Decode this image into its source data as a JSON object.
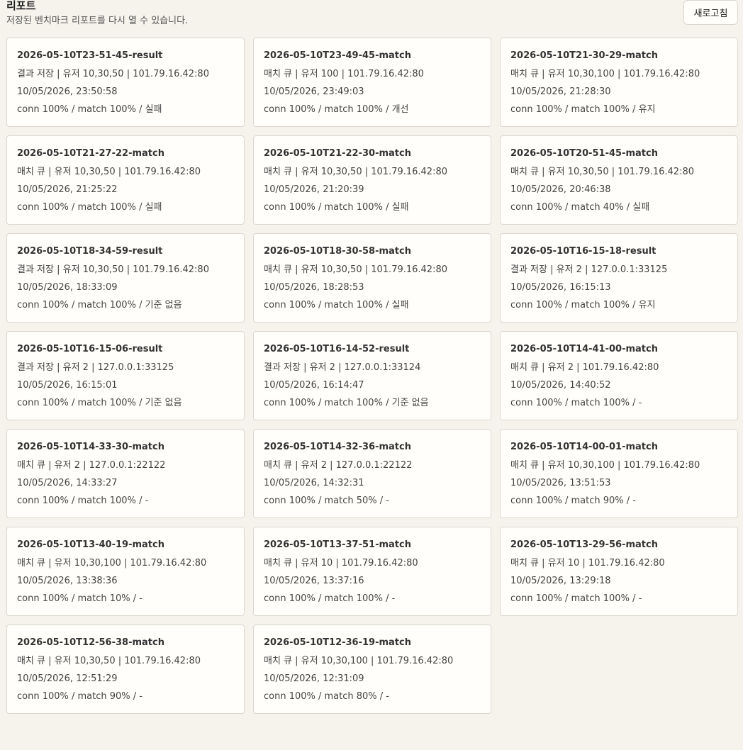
{
  "header": {
    "title": "리포트",
    "subtitle": "저장된 벤치마크 리포트를 다시 열 수 있습니다.",
    "refresh_label": "새로고침"
  },
  "reports": [
    {
      "title": "2026-05-10T23-51-45-result",
      "info": "결과 저장 | 유저 10,30,50 | 101.79.16.42:80",
      "date": "10/05/2026, 23:50:58",
      "summary": "conn 100% / match 100% / 실패"
    },
    {
      "title": "2026-05-10T23-49-45-match",
      "info": "매치 큐 | 유저 100 | 101.79.16.42:80",
      "date": "10/05/2026, 23:49:03",
      "summary": "conn 100% / match 100% / 개선"
    },
    {
      "title": "2026-05-10T21-30-29-match",
      "info": "매치 큐 | 유저 10,30,100 | 101.79.16.42:80",
      "date": "10/05/2026, 21:28:30",
      "summary": "conn 100% / match 100% / 유지"
    },
    {
      "title": "2026-05-10T21-27-22-match",
      "info": "매치 큐 | 유저 10,30,50 | 101.79.16.42:80",
      "date": "10/05/2026, 21:25:22",
      "summary": "conn 100% / match 100% / 실패"
    },
    {
      "title": "2026-05-10T21-22-30-match",
      "info": "매치 큐 | 유저 10,30,50 | 101.79.16.42:80",
      "date": "10/05/2026, 21:20:39",
      "summary": "conn 100% / match 100% / 실패"
    },
    {
      "title": "2026-05-10T20-51-45-match",
      "info": "매치 큐 | 유저 10,30,50 | 101.79.16.42:80",
      "date": "10/05/2026, 20:46:38",
      "summary": "conn 100% / match 40% / 실패"
    },
    {
      "title": "2026-05-10T18-34-59-result",
      "info": "결과 저장 | 유저 10,30,50 | 101.79.16.42:80",
      "date": "10/05/2026, 18:33:09",
      "summary": "conn 100% / match 100% / 기준 없음"
    },
    {
      "title": "2026-05-10T18-30-58-match",
      "info": "매치 큐 | 유저 10,30,50 | 101.79.16.42:80",
      "date": "10/05/2026, 18:28:53",
      "summary": "conn 100% / match 100% / 실패"
    },
    {
      "title": "2026-05-10T16-15-18-result",
      "info": "결과 저장 | 유저 2 | 127.0.0.1:33125",
      "date": "10/05/2026, 16:15:13",
      "summary": "conn 100% / match 100% / 유지"
    },
    {
      "title": "2026-05-10T16-15-06-result",
      "info": "결과 저장 | 유저 2 | 127.0.0.1:33125",
      "date": "10/05/2026, 16:15:01",
      "summary": "conn 100% / match 100% / 기준 없음"
    },
    {
      "title": "2026-05-10T16-14-52-result",
      "info": "결과 저장 | 유저 2 | 127.0.0.1:33124",
      "date": "10/05/2026, 16:14:47",
      "summary": "conn 100% / match 100% / 기준 없음"
    },
    {
      "title": "2026-05-10T14-41-00-match",
      "info": "매치 큐 | 유저 2 | 101.79.16.42:80",
      "date": "10/05/2026, 14:40:52",
      "summary": "conn 100% / match 100% / -"
    },
    {
      "title": "2026-05-10T14-33-30-match",
      "info": "매치 큐 | 유저 2 | 127.0.0.1:22122",
      "date": "10/05/2026, 14:33:27",
      "summary": "conn 100% / match 100% / -"
    },
    {
      "title": "2026-05-10T14-32-36-match",
      "info": "매치 큐 | 유저 2 | 127.0.0.1:22122",
      "date": "10/05/2026, 14:32:31",
      "summary": "conn 100% / match 50% / -"
    },
    {
      "title": "2026-05-10T14-00-01-match",
      "info": "매치 큐 | 유저 10,30,100 | 101.79.16.42:80",
      "date": "10/05/2026, 13:51:53",
      "summary": "conn 100% / match 90% / -"
    },
    {
      "title": "2026-05-10T13-40-19-match",
      "info": "매치 큐 | 유저 10,30,100 | 101.79.16.42:80",
      "date": "10/05/2026, 13:38:36",
      "summary": "conn 100% / match 10% / -"
    },
    {
      "title": "2026-05-10T13-37-51-match",
      "info": "매치 큐 | 유저 10 | 101.79.16.42:80",
      "date": "10/05/2026, 13:37:16",
      "summary": "conn 100% / match 100% / -"
    },
    {
      "title": "2026-05-10T13-29-56-match",
      "info": "매치 큐 | 유저 10 | 101.79.16.42:80",
      "date": "10/05/2026, 13:29:18",
      "summary": "conn 100% / match 100% / -"
    },
    {
      "title": "2026-05-10T12-56-38-match",
      "info": "매치 큐 | 유저 10,30,50 | 101.79.16.42:80",
      "date": "10/05/2026, 12:51:29",
      "summary": "conn 100% / match 90% / -"
    },
    {
      "title": "2026-05-10T12-36-19-match",
      "info": "매치 큐 | 유저 10,30,100 | 101.79.16.42:80",
      "date": "10/05/2026, 12:31:09",
      "summary": "conn 100% / match 80% / -"
    }
  ]
}
